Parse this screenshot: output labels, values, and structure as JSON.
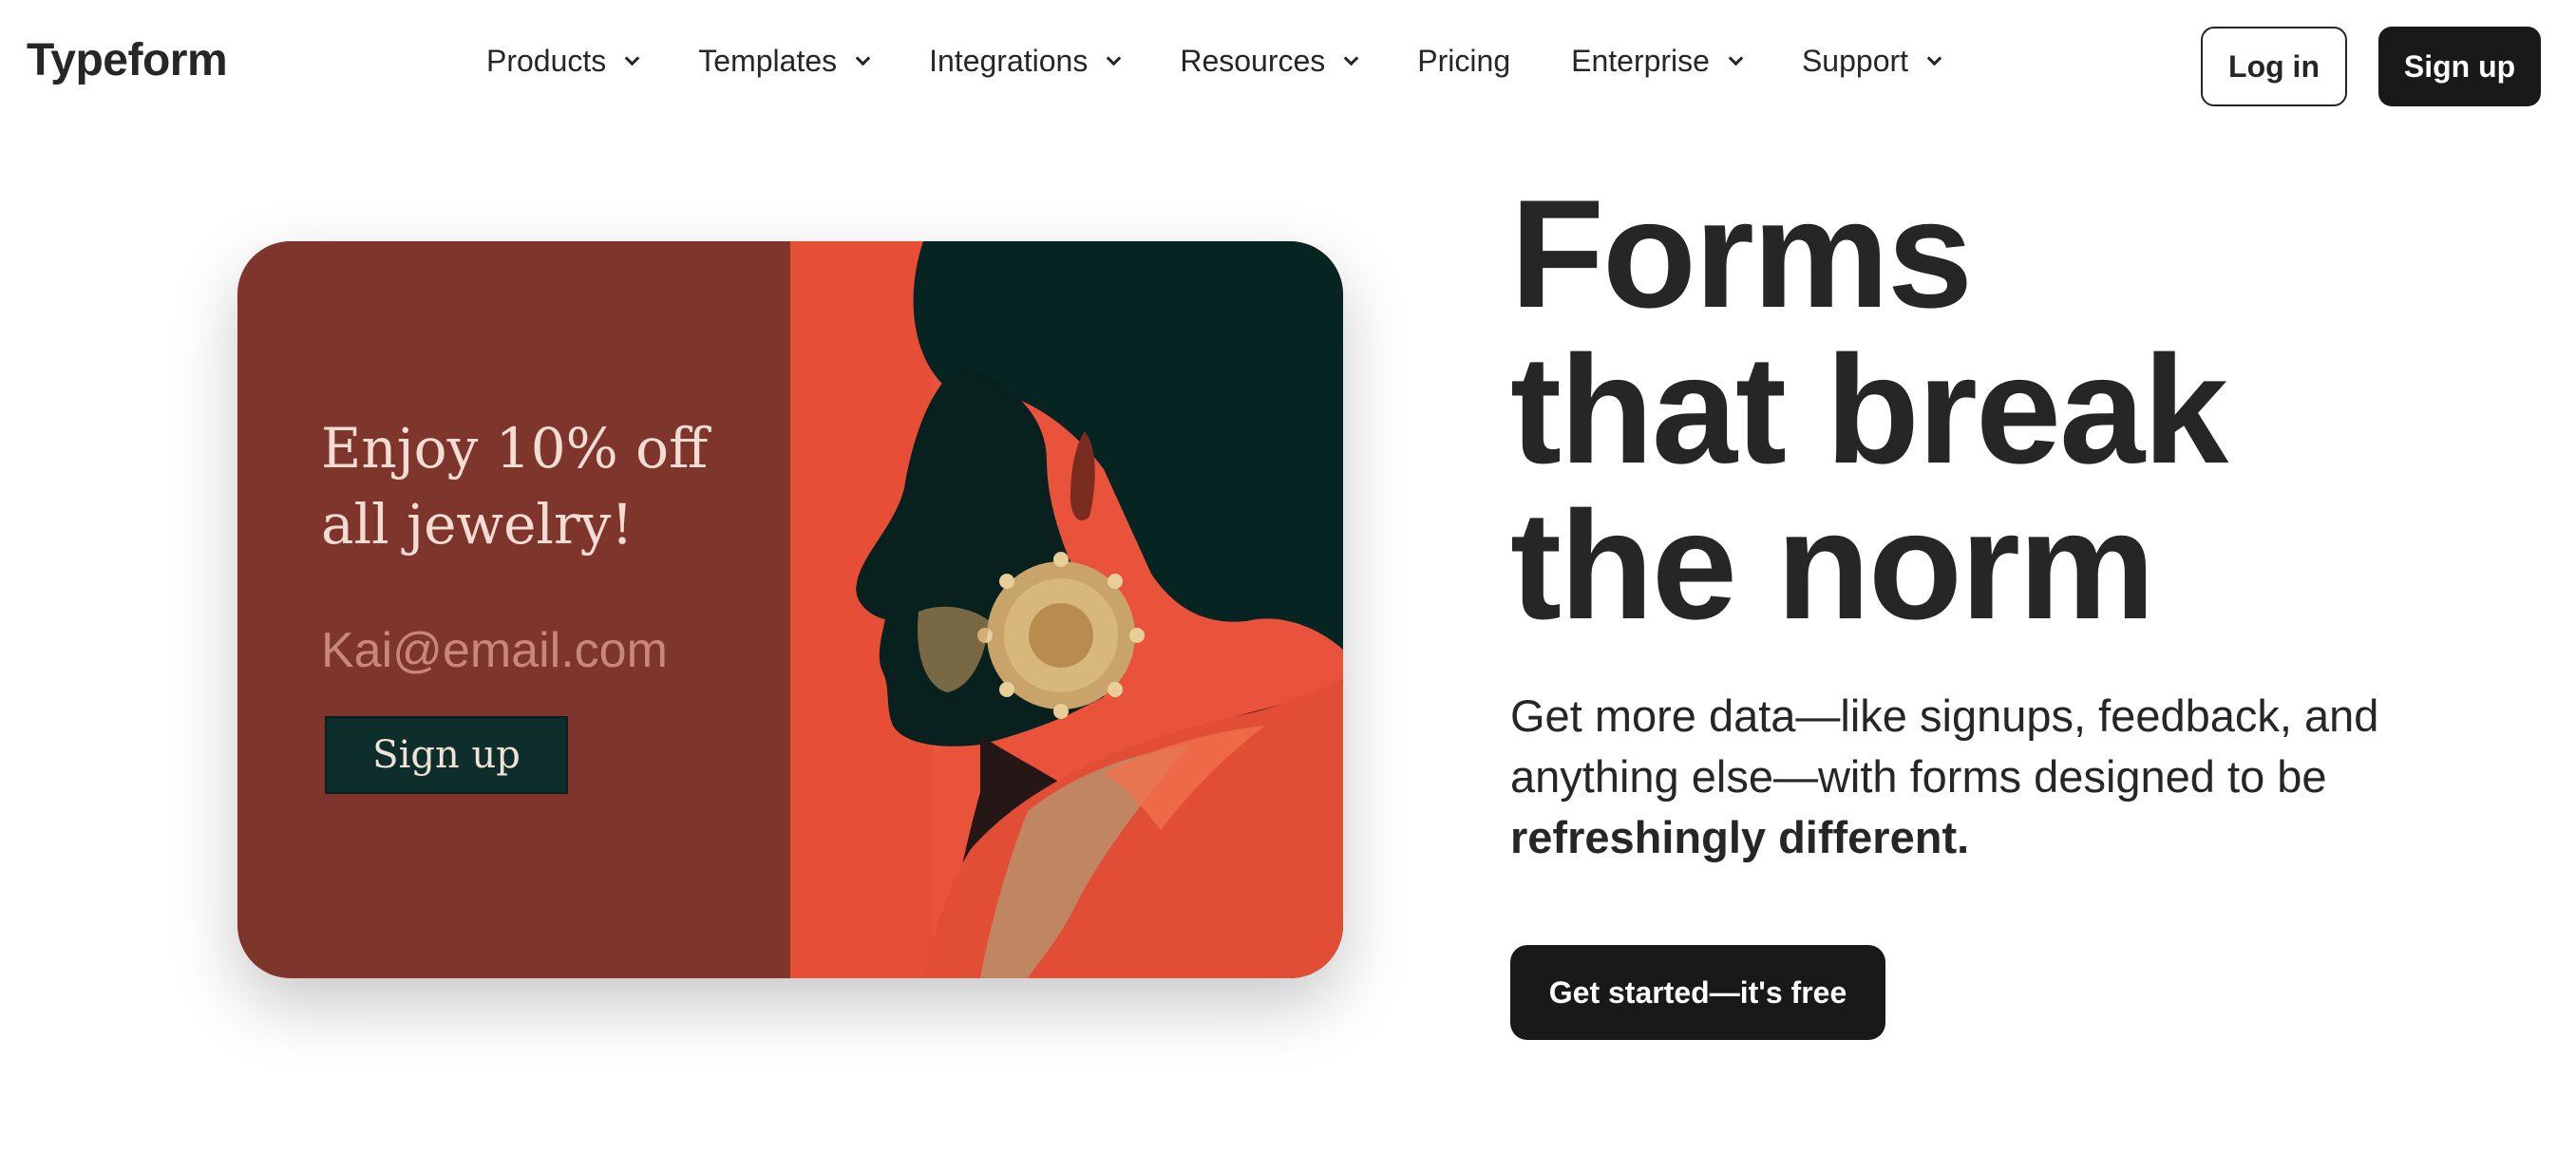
{
  "header": {
    "logo": "Typeform",
    "nav": [
      {
        "label": "Products",
        "dropdown": true
      },
      {
        "label": "Templates",
        "dropdown": true
      },
      {
        "label": "Integrations",
        "dropdown": true
      },
      {
        "label": "Resources",
        "dropdown": true
      },
      {
        "label": "Pricing",
        "dropdown": false
      },
      {
        "label": "Enterprise",
        "dropdown": true
      },
      {
        "label": "Support",
        "dropdown": true
      }
    ],
    "login_label": "Log in",
    "signup_label": "Sign up"
  },
  "hero_card": {
    "headline": "Enjoy 10% off all jewelry!",
    "email_placeholder": "Kai@email.com",
    "button_label": "Sign up",
    "colors": {
      "left_panel": "#7e352c",
      "photo_bg": "#e9533b",
      "button": "#0e2e2c"
    }
  },
  "hero": {
    "title_lines": [
      "Forms",
      "that break",
      "the norm"
    ],
    "subtitle_regular": "Get more data—like signups, feedback, and anything else—with forms designed to be",
    "subtitle_bold": "refreshingly different.",
    "cta_label": "Get started—it's free"
  },
  "icons": [
    "chevron-down-icon"
  ],
  "colors": {
    "text": "#262627",
    "primary_button": "#191919"
  }
}
